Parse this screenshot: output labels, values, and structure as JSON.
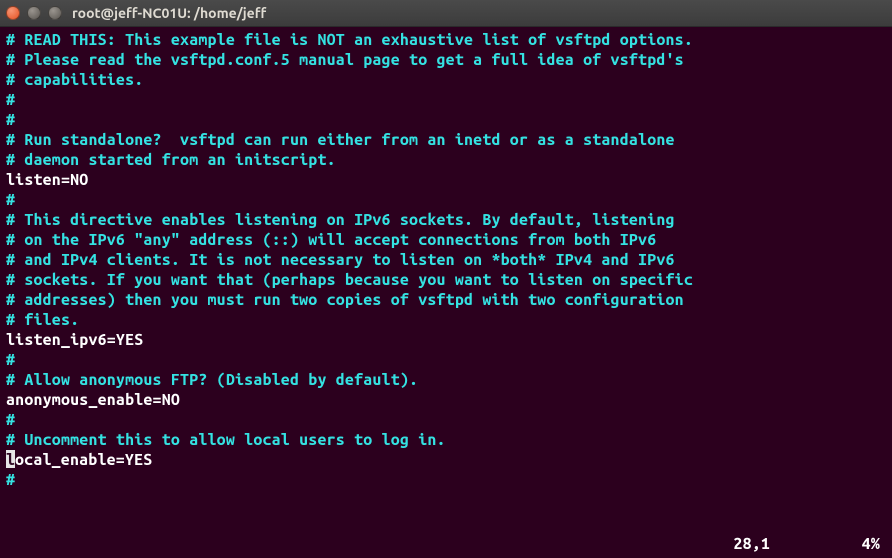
{
  "window": {
    "title": "root@jeff-NC01U: /home/jeff"
  },
  "lines": {
    "l0": "# READ THIS: This example file is NOT an exhaustive list of vsftpd options.",
    "l1": "# Please read the vsftpd.conf.5 manual page to get a full idea of vsftpd's",
    "l2": "# capabilities.",
    "l3": "#",
    "l4": "#",
    "l5": "# Run standalone?  vsftpd can run either from an inetd or as a standalone",
    "l6": "# daemon started from an initscript.",
    "l7": "listen=NO",
    "l8": "#",
    "l9": "# This directive enables listening on IPv6 sockets. By default, listening",
    "l10": "# on the IPv6 \"any\" address (::) will accept connections from both IPv6",
    "l11": "# and IPv4 clients. It is not necessary to listen on *both* IPv4 and IPv6",
    "l12": "# sockets. If you want that (perhaps because you want to listen on specific",
    "l13": "# addresses) then you must run two copies of vsftpd with two configuration",
    "l14": "# files.",
    "l15": "listen_ipv6=YES",
    "l16": "#",
    "l17": "# Allow anonymous FTP? (Disabled by default).",
    "l18": "anonymous_enable=NO",
    "l19": "#",
    "l20": "# Uncomment this to allow local users to log in.",
    "l21_rest": "ocal_enable=YES",
    "l22": "#"
  },
  "cursor_char": "l",
  "status": {
    "pos": "28,1",
    "pct": "4%"
  }
}
